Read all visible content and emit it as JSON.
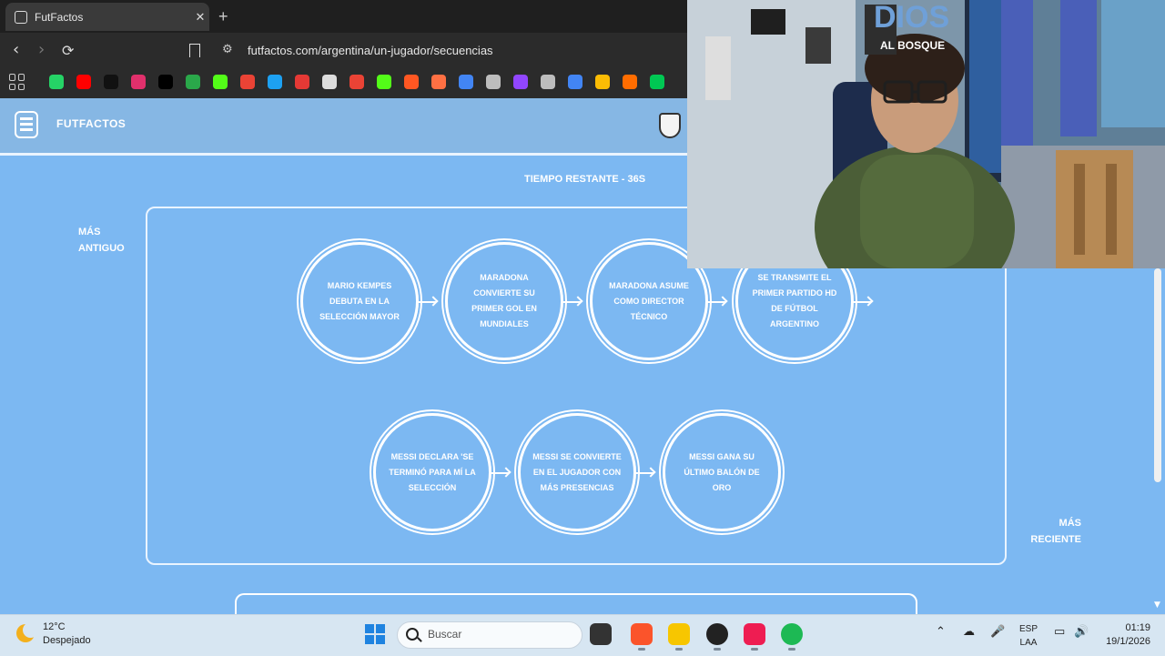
{
  "browser": {
    "tab_title": "FutFactos",
    "tab_close": "✕",
    "new_tab": "+",
    "url": "futfactos.com/argentina/un-jugador/secuencias",
    "nav_back": "‹",
    "nav_forward": "›",
    "nav_reload": "⟳",
    "bookmarks": [
      {
        "icon": "whatsapp-icon",
        "color": "#25d366"
      },
      {
        "icon": "youtube-icon",
        "color": "#ff0000"
      },
      {
        "icon": "tiktok-icon",
        "color": "#111111"
      },
      {
        "icon": "instagram-icon",
        "color": "#e1306c"
      },
      {
        "icon": "x-icon",
        "color": "#000000"
      },
      {
        "icon": "soccer-site-icon",
        "color": "#2aa84a"
      },
      {
        "icon": "kick-icon",
        "color": "#53fc18"
      },
      {
        "icon": "gmail-icon",
        "color": "#ea4335"
      },
      {
        "icon": "site-icon",
        "color": "#1da1f2"
      },
      {
        "icon": "chart-icon",
        "color": "#e53935"
      },
      {
        "icon": "speed-icon",
        "color": "#dddddd"
      },
      {
        "icon": "gmail-icon",
        "color": "#ea4335"
      },
      {
        "icon": "kick-icon",
        "color": "#53fc18"
      },
      {
        "icon": "search-site-icon",
        "color": "#ff5722"
      },
      {
        "icon": "site-icon",
        "color": "#ff7043"
      },
      {
        "icon": "grid-site-icon",
        "color": "#4285f4"
      },
      {
        "icon": "chess-icon",
        "color": "#bdbdbd"
      },
      {
        "icon": "twitch-icon",
        "color": "#9146ff"
      },
      {
        "icon": "settings-site-icon",
        "color": "#bdbdbd"
      },
      {
        "icon": "docs-icon",
        "color": "#4285f4"
      },
      {
        "icon": "drive-icon",
        "color": "#fbbc04"
      },
      {
        "icon": "site-icon",
        "color": "#ff6d00"
      },
      {
        "icon": "d-site-icon",
        "color": "#00c853"
      }
    ]
  },
  "site": {
    "brand": "FUTFACTOS",
    "timer": "TIEMPO RESTANTE - 36S",
    "label_old": "MÁS ANTIGUO",
    "label_new": "MÁS RECIENTE",
    "sequence": [
      "MARIO KEMPES DEBUTA EN LA SELECCIÓN MAYOR",
      "MARADONA CONVIERTE SU PRIMER GOL EN MUNDIALES",
      "MARADONA ASUME COMO DIRECTOR TÉCNICO",
      "SE TRANSMITE EL PRIMER PARTIDO HD DE FÚTBOL ARGENTINO",
      "MESSI DECLARA 'SE TERMINÓ PARA MÍ LA SELECCIÓN",
      "MESSI SE CONVIERTE EN EL JUGADOR CON MÁS PRESENCIAS",
      "MESSI GANA SU ÚLTIMO BALÓN DE ORO"
    ]
  },
  "webcam": {
    "wall_text_1": "DIOS",
    "wall_text_2": "AL BOSQUE"
  },
  "taskbar": {
    "temperature": "12°C",
    "condition": "Despejado",
    "search_placeholder": "Buscar",
    "lang_line1": "ESP",
    "lang_line2": "LAA",
    "time": "01:19",
    "date": "19/1/2026",
    "apps": [
      {
        "icon": "task-view-icon",
        "color": "#333333"
      },
      {
        "icon": "brave-icon",
        "color": "#fb542b"
      },
      {
        "icon": "file-explorer-icon",
        "color": "#f7c600"
      },
      {
        "icon": "obs-icon",
        "color": "#222222"
      },
      {
        "icon": "tiktok-icon",
        "color": "#ee1d52"
      },
      {
        "icon": "spotify-icon",
        "color": "#1db954"
      }
    ]
  }
}
